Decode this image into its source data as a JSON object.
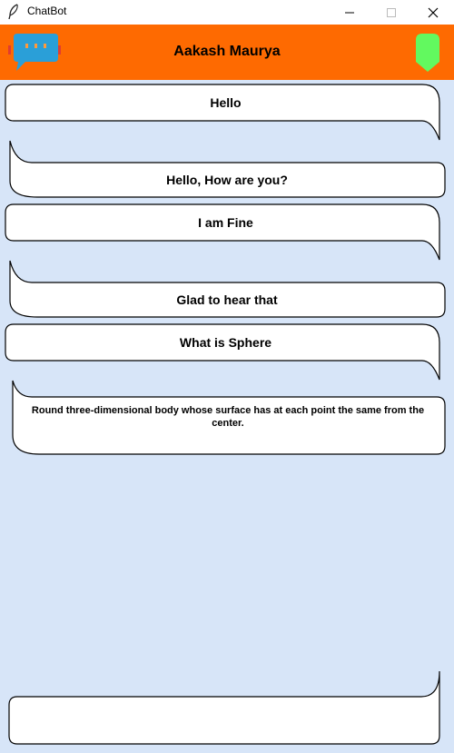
{
  "window": {
    "title": "ChatBot",
    "controls": {
      "minimize": "—",
      "maximize": "☐",
      "close": "✕"
    }
  },
  "header": {
    "title": "Aakash Maurya",
    "background": "#fe6a01",
    "left_icon": "chat-bot-icon",
    "right_icon": "shield-icon"
  },
  "chat": {
    "background": "#d7e5f8",
    "messages": [
      {
        "sender": "user",
        "text": "Hello"
      },
      {
        "sender": "bot",
        "text": "Hello, How are you?"
      },
      {
        "sender": "user",
        "text": "I am Fine"
      },
      {
        "sender": "bot",
        "text": "Glad to hear that"
      },
      {
        "sender": "user",
        "text": "What is Sphere"
      },
      {
        "sender": "bot",
        "text": "Round three-dimensional body whose surface has at each point the same from the center."
      }
    ]
  },
  "input": {
    "value": "",
    "placeholder": ""
  }
}
